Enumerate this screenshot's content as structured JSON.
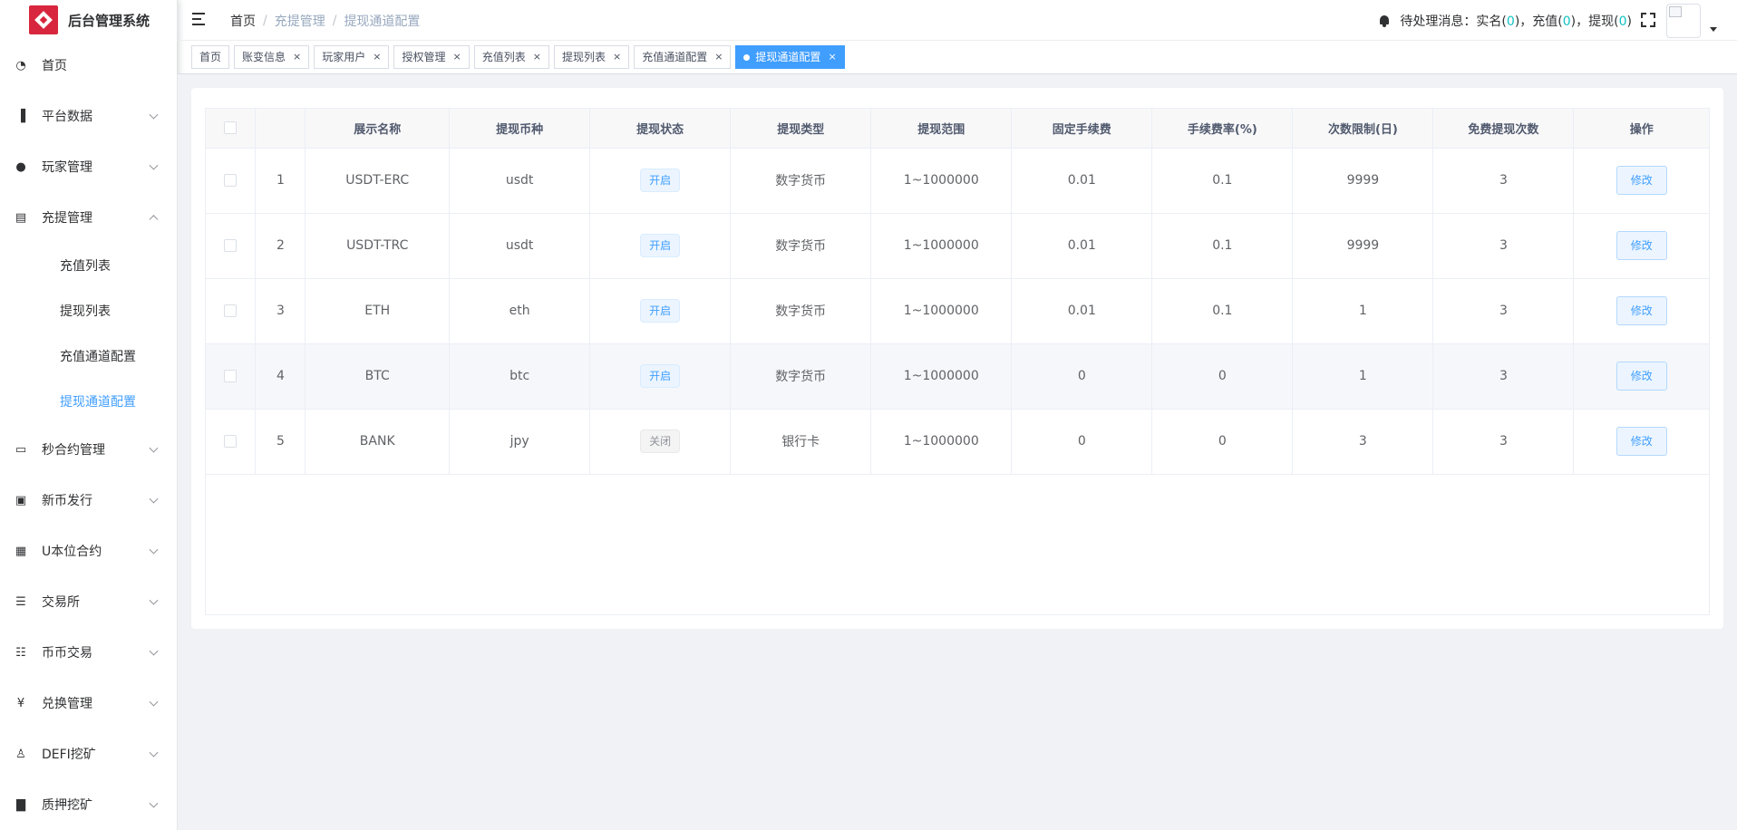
{
  "app": {
    "title": "后台管理系统"
  },
  "sidebar": {
    "items": [
      {
        "label": "首页",
        "icon": "dashboard-icon"
      },
      {
        "label": "平台数据",
        "icon": "data-icon"
      },
      {
        "label": "玩家管理",
        "icon": "user-icon"
      },
      {
        "label": "充提管理",
        "icon": "wallet-icon",
        "expanded": true,
        "children": [
          "充值列表",
          "提现列表",
          "充值通道配置",
          "提现通道配置"
        ]
      },
      {
        "label": "秒合约管理",
        "icon": "chart-icon"
      },
      {
        "label": "新币发行",
        "icon": "coin-icon"
      },
      {
        "label": "U本位合约",
        "icon": "grid-icon"
      },
      {
        "label": "交易所",
        "icon": "tree-list-icon"
      },
      {
        "label": "币币交易",
        "icon": "list-icon"
      },
      {
        "label": "兑换管理",
        "icon": "yen-icon"
      },
      {
        "label": "DEFI挖矿",
        "icon": "miner-icon"
      },
      {
        "label": "质押挖矿",
        "icon": "bar-chart-icon"
      }
    ],
    "active_child": "提现通道配置"
  },
  "header": {
    "breadcrumb": [
      "首页",
      "充提管理",
      "提现通道配置"
    ],
    "notice": {
      "prefix": "待处理消息：",
      "items": [
        {
          "label": "实名",
          "count": "0"
        },
        {
          "label": "充值",
          "count": "0"
        },
        {
          "label": "提现",
          "count": "0"
        }
      ]
    }
  },
  "tags": [
    {
      "label": "首页",
      "closable": false,
      "active": false
    },
    {
      "label": "账变信息",
      "closable": true,
      "active": false
    },
    {
      "label": "玩家用户",
      "closable": true,
      "active": false
    },
    {
      "label": "授权管理",
      "closable": true,
      "active": false
    },
    {
      "label": "充值列表",
      "closable": true,
      "active": false
    },
    {
      "label": "提现列表",
      "closable": true,
      "active": false
    },
    {
      "label": "充值通道配置",
      "closable": true,
      "active": false
    },
    {
      "label": "提现通道配置",
      "closable": true,
      "active": true
    }
  ],
  "table": {
    "columns": [
      "",
      "",
      "展示名称",
      "提现币种",
      "提现状态",
      "提现类型",
      "提现范围",
      "固定手续费",
      "手续费率(%)",
      "次数限制(日)",
      "免费提现次数",
      "操作"
    ],
    "rows": [
      {
        "index": "1",
        "name": "USDT-ERC",
        "coin": "usdt",
        "status": "开启",
        "status_on": true,
        "type": "数字货币",
        "range": "1~1000000",
        "fixed_fee": "0.01",
        "fee_rate": "0.1",
        "daily_limit": "9999",
        "free_times": "3",
        "action": "修改"
      },
      {
        "index": "2",
        "name": "USDT-TRC",
        "coin": "usdt",
        "status": "开启",
        "status_on": true,
        "type": "数字货币",
        "range": "1~1000000",
        "fixed_fee": "0.01",
        "fee_rate": "0.1",
        "daily_limit": "9999",
        "free_times": "3",
        "action": "修改"
      },
      {
        "index": "3",
        "name": "ETH",
        "coin": "eth",
        "status": "开启",
        "status_on": true,
        "type": "数字货币",
        "range": "1~1000000",
        "fixed_fee": "0.01",
        "fee_rate": "0.1",
        "daily_limit": "1",
        "free_times": "3",
        "action": "修改"
      },
      {
        "index": "4",
        "name": "BTC",
        "coin": "btc",
        "status": "开启",
        "status_on": true,
        "type": "数字货币",
        "range": "1~1000000",
        "fixed_fee": "0",
        "fee_rate": "0",
        "daily_limit": "1",
        "free_times": "3",
        "action": "修改",
        "highlighted": true
      },
      {
        "index": "5",
        "name": "BANK",
        "coin": "jpy",
        "status": "关闭",
        "status_on": false,
        "type": "银行卡",
        "range": "1~1000000",
        "fixed_fee": "0",
        "fee_rate": "0",
        "daily_limit": "3",
        "free_times": "3",
        "action": "修改"
      }
    ]
  },
  "colors": {
    "accent": "#409eff",
    "count": "#13c2c2",
    "logo": "#d7263d"
  }
}
